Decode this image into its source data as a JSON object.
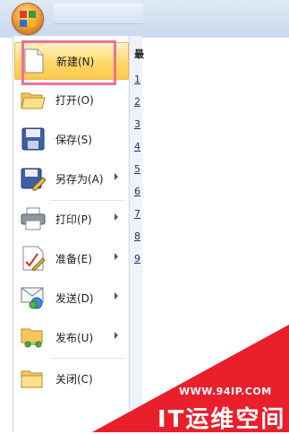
{
  "menu": {
    "items": [
      {
        "label": "新建(N)",
        "icon": "new-document-icon",
        "has_submenu": false
      },
      {
        "label": "打开(O)",
        "icon": "open-folder-icon",
        "has_submenu": false
      },
      {
        "label": "保存(S)",
        "icon": "save-disk-icon",
        "has_submenu": false
      },
      {
        "label": "另存为(A)",
        "icon": "save-as-icon",
        "has_submenu": true
      },
      {
        "label": "打印(P)",
        "icon": "printer-icon",
        "has_submenu": true
      },
      {
        "label": "准备(E)",
        "icon": "prepare-icon",
        "has_submenu": true
      },
      {
        "label": "发送(D)",
        "icon": "send-icon",
        "has_submenu": true
      },
      {
        "label": "发布(U)",
        "icon": "publish-icon",
        "has_submenu": true
      },
      {
        "label": "关闭(C)",
        "icon": "close-folder-icon",
        "has_submenu": false
      }
    ]
  },
  "recent": {
    "title": "最",
    "numbers": [
      "1",
      "2",
      "3",
      "4",
      "5",
      "6",
      "7",
      "8",
      "9"
    ]
  },
  "watermark": {
    "url": "WWW.94IP.COM",
    "text": "IT运维空间"
  },
  "colors": {
    "accent": "#ee6f9f",
    "watermark_red": "#ea1f2c",
    "selected_bg": "#ffd86a"
  }
}
